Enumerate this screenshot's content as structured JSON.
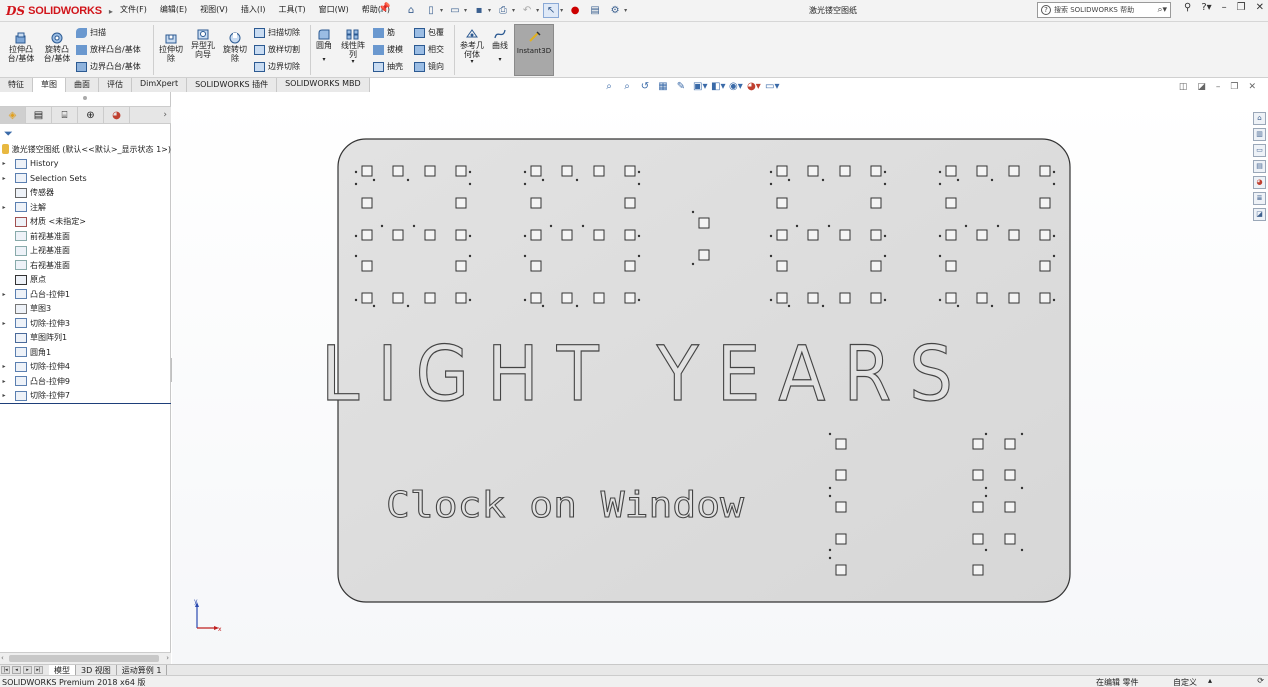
{
  "app": {
    "logo_ds": "DS",
    "logo_text": "SOLIDWORKS",
    "doc_title": "激光镂空图纸"
  },
  "menu": [
    "文件(F)",
    "编辑(E)",
    "视图(V)",
    "插入(I)",
    "工具(T)",
    "窗口(W)",
    "帮助(H)"
  ],
  "search": {
    "placeholder": "搜索 SOLIDWORKS 帮助"
  },
  "ribbon": {
    "extrude_boss": "拉伸凸台/基体",
    "revolve_boss": "旋转凸台/基体",
    "sweep": "扫描",
    "loft": "放样凸台/基体",
    "boundary_boss": "边界凸台/基体",
    "extrude_cut": "拉伸切除",
    "hole_wizard": "异型孔向导",
    "revolve_cut": "旋转切除",
    "swept_cut": "扫描切除",
    "lofted_cut": "放样切割",
    "boundary_cut": "边界切除",
    "fillet": "圆角",
    "linear_pattern": "线性阵列",
    "rib": "筋",
    "draft": "拔模",
    "shell": "抽壳",
    "wrap": "包覆",
    "intersect": "相交",
    "mirror": "镜向",
    "reference_geometry": "参考几何体",
    "curves": "曲线",
    "instant3d": "Instant3D"
  },
  "tabs": [
    "特征",
    "草图",
    "曲面",
    "评估",
    "DimXpert",
    "SOLIDWORKS 插件",
    "SOLIDWORKS MBD"
  ],
  "tree": {
    "root": "激光镂空图纸  (默认<<默认>_显示状态 1>)",
    "items": [
      {
        "label": "History",
        "expand": true
      },
      {
        "label": "Selection Sets",
        "expand": true
      },
      {
        "label": "传感器",
        "expand": false
      },
      {
        "label": "注解",
        "expand": true
      },
      {
        "label": "材质 <未指定>",
        "expand": false
      },
      {
        "label": "前视基准面",
        "expand": false
      },
      {
        "label": "上视基准面",
        "expand": false
      },
      {
        "label": "右视基准面",
        "expand": false
      },
      {
        "label": "原点",
        "expand": false
      },
      {
        "label": "凸台-拉伸1",
        "expand": true
      },
      {
        "label": "草图3",
        "expand": false
      },
      {
        "label": "切除-拉伸3",
        "expand": true
      },
      {
        "label": "草图阵列1",
        "expand": false
      },
      {
        "label": "圆角1",
        "expand": false
      },
      {
        "label": "切除-拉伸4",
        "expand": true
      },
      {
        "label": "凸台-拉伸9",
        "expand": true
      },
      {
        "label": "切除-拉伸7",
        "expand": true
      }
    ]
  },
  "part": {
    "title_text": "LIGHT YEARS",
    "subtitle_text": "Clock on Window"
  },
  "triad": {
    "x": "x",
    "y": "y"
  },
  "bottom_tabs": [
    "模型",
    "3D 视图",
    "运动算例 1"
  ],
  "status": {
    "left": "SOLIDWORKS Premium 2018 x64 版",
    "editing": "在编辑 零件",
    "custom": "自定义"
  }
}
